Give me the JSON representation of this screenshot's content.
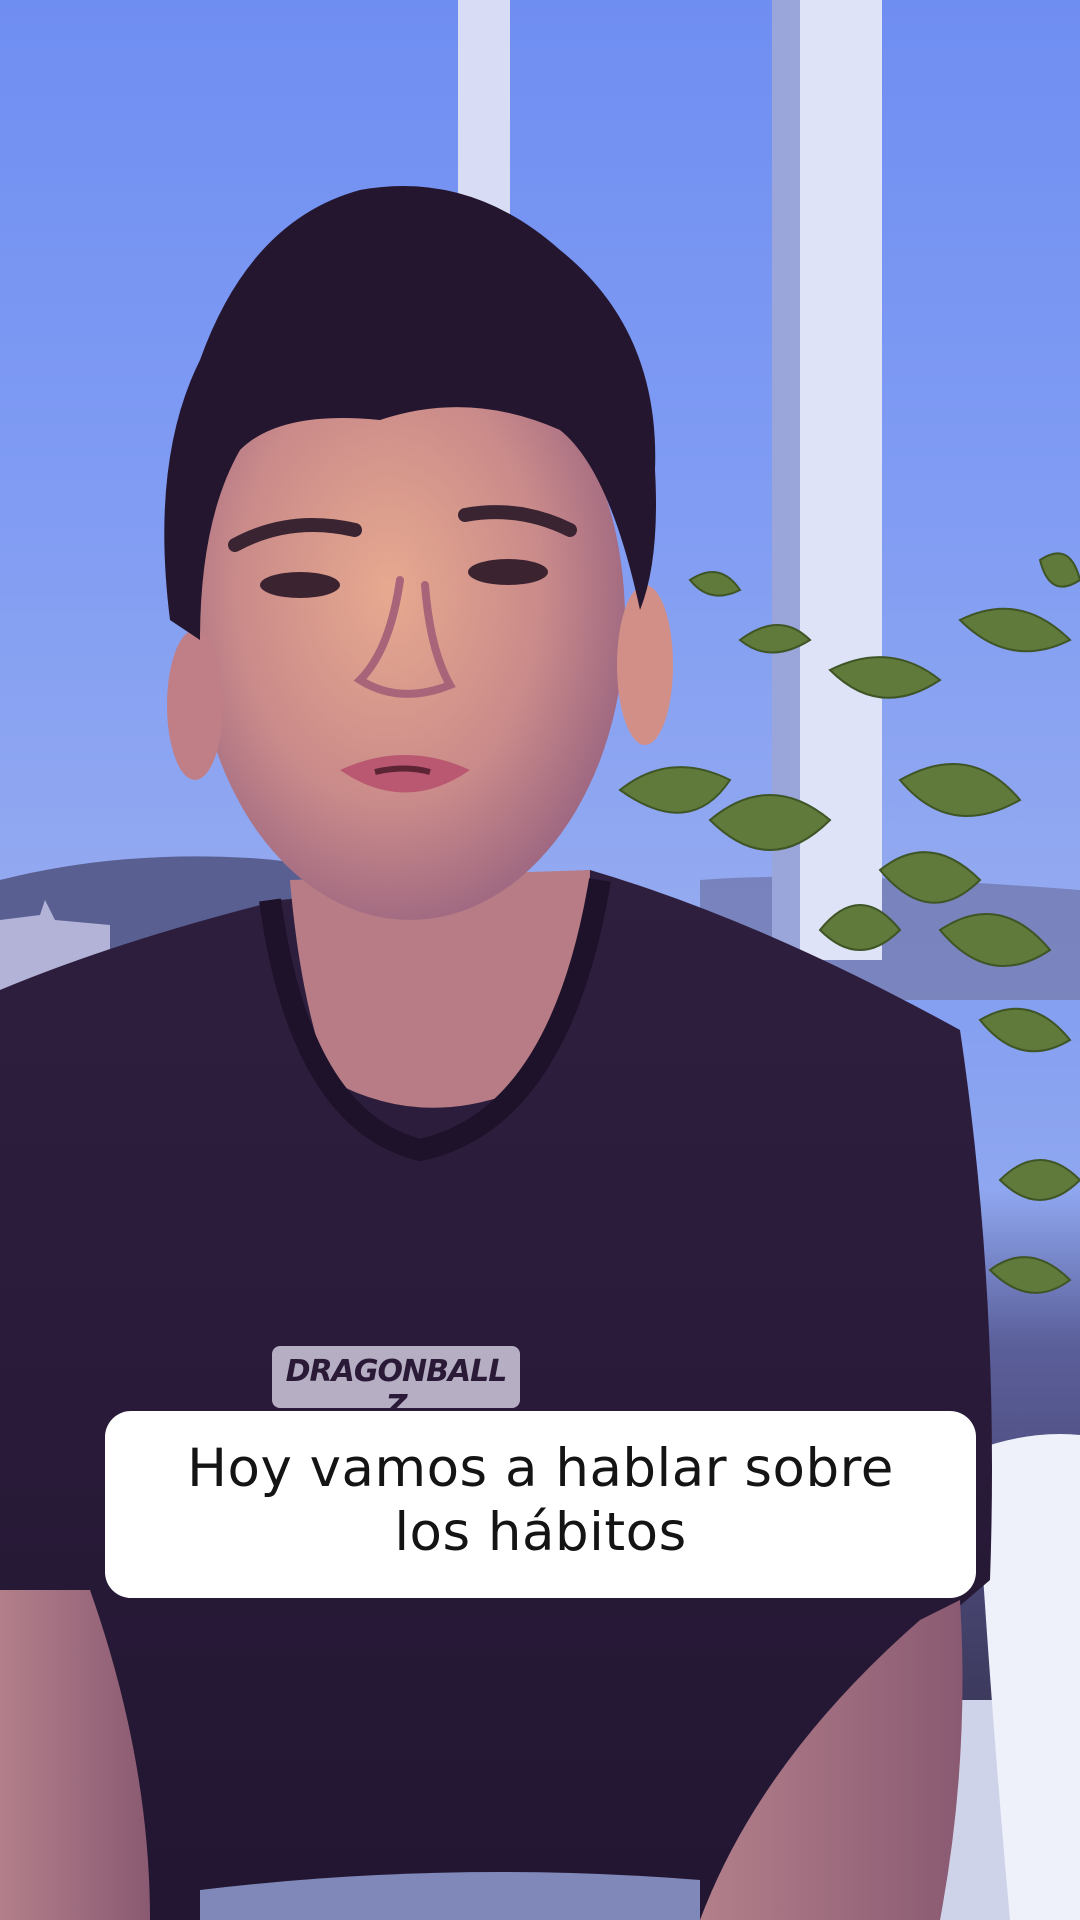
{
  "caption": {
    "text": "Hoy vamos a hablar sobre\nlos hábitos"
  },
  "shirt_print": {
    "text": "DRAGONBALL Z"
  },
  "colors": {
    "sky": "#7e9af2",
    "shirt": "#2a1a38",
    "skin": "#c98a8a",
    "hair": "#24162e",
    "leaf": "#5f7a3a",
    "caption_bg": "#ffffff",
    "caption_text": "#141414"
  }
}
